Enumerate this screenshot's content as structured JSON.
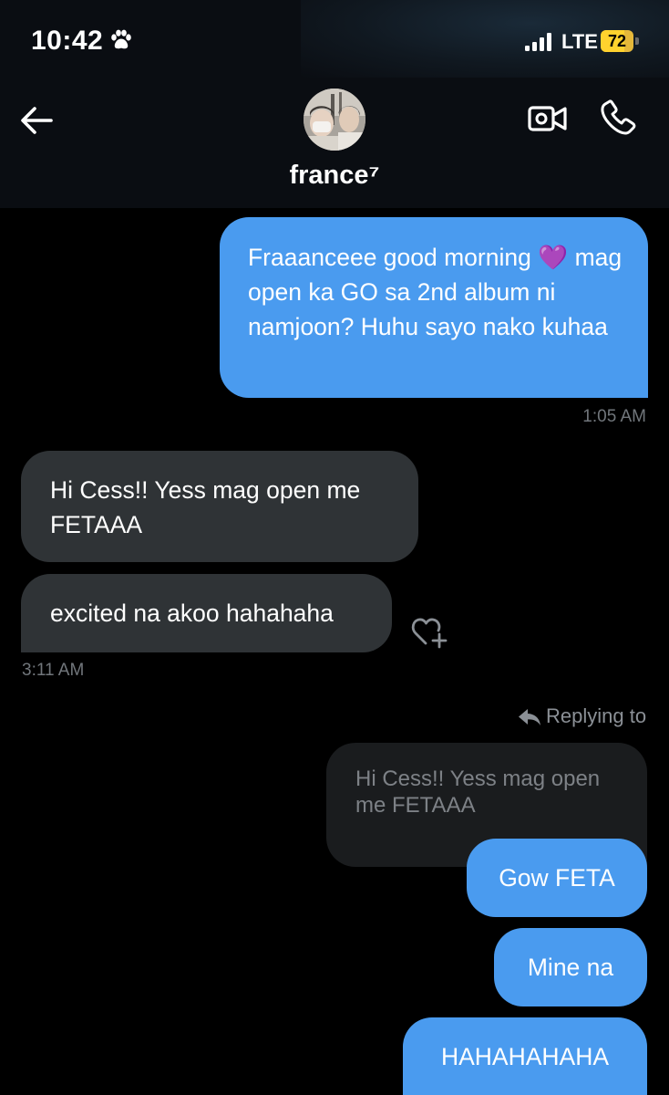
{
  "status_bar": {
    "time": "10:42",
    "time_icon": "paw-icon",
    "signal_icon": "signal-bars-icon",
    "network": "LTE",
    "battery_level": 72,
    "battery_percent": "72",
    "battery_color": "#ffd22e"
  },
  "header": {
    "back_icon": "back-arrow-icon",
    "avatar": "contact-avatar",
    "contact_name": "france⁷",
    "video_icon": "video-camera-icon",
    "phone_icon": "phone-icon"
  },
  "messages": [
    {
      "direction": "outgoing",
      "text": "Fraaanceee good morning 💜 mag open ka GO sa 2nd album ni namjoon? Huhu sayo nako kuhaa"
    },
    {
      "direction": "outgoing",
      "timestamp": "1:05 AM"
    },
    {
      "direction": "incoming",
      "text": "Hi Cess!! Yess mag open me FETAAA"
    },
    {
      "direction": "incoming",
      "text": "excited na akoo hahahaha",
      "reaction_icon": "add-reaction-heart-icon"
    },
    {
      "direction": "incoming",
      "timestamp": "3:11 AM"
    },
    {
      "direction": "outgoing",
      "replying_to_label": "Replying to",
      "reply_icon": "reply-arrow-icon",
      "quoted_text": "Hi Cess!! Yess mag open me FETAAA"
    },
    {
      "direction": "outgoing",
      "text": "Gow FETA"
    },
    {
      "direction": "outgoing",
      "text": "Mine na"
    },
    {
      "direction": "outgoing",
      "text": "HAHAHAHAHA"
    }
  ],
  "colors": {
    "outgoing_bubble": "#4a9bef",
    "incoming_bubble": "#2f3336",
    "reply_preview": "#1a1c1e",
    "background": "#000000",
    "header_background": "#0a0d12",
    "timestamp": "#71767b"
  }
}
